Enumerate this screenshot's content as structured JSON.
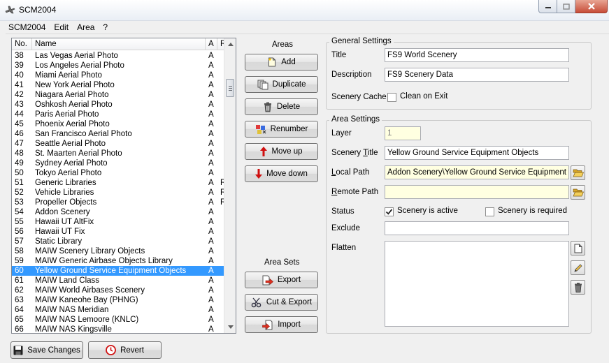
{
  "window": {
    "title": "SCM2004"
  },
  "menu": [
    "SCM2004",
    "Edit",
    "Area",
    "?"
  ],
  "list": {
    "headers": {
      "no": "No.",
      "name": "Name",
      "a": "A",
      "r": "R"
    },
    "rows": [
      {
        "no": "38",
        "name": "Las Vegas Aerial Photo",
        "a": "A",
        "r": ""
      },
      {
        "no": "39",
        "name": "Los Angeles Aerial Photo",
        "a": "A",
        "r": ""
      },
      {
        "no": "40",
        "name": "Miami Aerial Photo",
        "a": "A",
        "r": ""
      },
      {
        "no": "41",
        "name": "New York Aerial Photo",
        "a": "A",
        "r": ""
      },
      {
        "no": "42",
        "name": "Niagara Aerial Photo",
        "a": "A",
        "r": ""
      },
      {
        "no": "43",
        "name": "Oshkosh Aerial Photo",
        "a": "A",
        "r": ""
      },
      {
        "no": "44",
        "name": "Paris Aerial Photo",
        "a": "A",
        "r": ""
      },
      {
        "no": "45",
        "name": "Phoenix Aerial Photo",
        "a": "A",
        "r": ""
      },
      {
        "no": "46",
        "name": "San Francisco Aerial Photo",
        "a": "A",
        "r": ""
      },
      {
        "no": "47",
        "name": "Seattle Aerial Photo",
        "a": "A",
        "r": ""
      },
      {
        "no": "48",
        "name": "St. Maarten Aerial Photo",
        "a": "A",
        "r": ""
      },
      {
        "no": "49",
        "name": "Sydney Aerial Photo",
        "a": "A",
        "r": ""
      },
      {
        "no": "50",
        "name": "Tokyo Aerial Photo",
        "a": "A",
        "r": ""
      },
      {
        "no": "51",
        "name": "Generic Libraries",
        "a": "A",
        "r": "R"
      },
      {
        "no": "52",
        "name": "Vehicle Libraries",
        "a": "A",
        "r": "R"
      },
      {
        "no": "53",
        "name": "Propeller Objects",
        "a": "A",
        "r": "R"
      },
      {
        "no": "54",
        "name": "Addon Scenery",
        "a": "A",
        "r": ""
      },
      {
        "no": "55",
        "name": "Hawaii UT AltFix",
        "a": "A",
        "r": ""
      },
      {
        "no": "56",
        "name": "Hawaii UT Fix",
        "a": "A",
        "r": ""
      },
      {
        "no": "57",
        "name": "Static Library",
        "a": "A",
        "r": ""
      },
      {
        "no": "58",
        "name": "MAIW Scenery Library Objects",
        "a": "A",
        "r": ""
      },
      {
        "no": "59",
        "name": "MAIW Generic Airbase Objects Library",
        "a": "A",
        "r": ""
      },
      {
        "no": "60",
        "name": "Yellow Ground Service Equipment Objects",
        "a": "A",
        "r": "",
        "selected": true
      },
      {
        "no": "61",
        "name": "MAIW Land Class",
        "a": "A",
        "r": ""
      },
      {
        "no": "62",
        "name": "MAIW World Airbases Scenery",
        "a": "A",
        "r": ""
      },
      {
        "no": "63",
        "name": "MAIW Kaneohe Bay (PHNG)",
        "a": "A",
        "r": ""
      },
      {
        "no": "64",
        "name": "MAIW NAS Meridian",
        "a": "A",
        "r": ""
      },
      {
        "no": "65",
        "name": "MAIW NAS Lemoore (KNLC)",
        "a": "A",
        "r": ""
      },
      {
        "no": "66",
        "name": "MAIW NAS Kingsville",
        "a": "A",
        "r": ""
      }
    ]
  },
  "areas": {
    "label": "Areas",
    "add": "Add",
    "duplicate": "Duplicate",
    "delete": "Delete",
    "renumber": "Renumber",
    "move_up": "Move up",
    "move_down": "Move down"
  },
  "area_sets": {
    "label": "Area Sets",
    "export": "Export",
    "cut_export": "Cut & Export",
    "import": "Import"
  },
  "general": {
    "title": "General Settings",
    "title_label": "Title",
    "title_value": "FS9 World Scenery",
    "description_label": "Description",
    "description_value": "FS9 Scenery Data",
    "cache_label": "Scenery Cache",
    "cache_checkbox_label": "Clean on Exit",
    "cache_checked": false
  },
  "area_settings": {
    "title": "Area Settings",
    "layer_label": "Layer",
    "layer_value": "1",
    "scenery_title_label": "Scenery Title",
    "scenery_title_value": "Yellow Ground Service Equipment Objects",
    "local_path_label": "Local Path",
    "local_path_value": "Addon Scenery\\Yellow Ground Service Equipment Obj",
    "remote_path_label": "Remote Path",
    "remote_path_value": "",
    "status_label": "Status",
    "active_label": "Scenery is active",
    "active_checked": true,
    "required_label": "Scenery is required",
    "required_checked": false,
    "exclude_label": "Exclude",
    "exclude_value": "",
    "flatten_label": "Flatten"
  },
  "footer": {
    "save": "Save Changes",
    "revert": "Revert"
  },
  "colors": {
    "selection": "#3399ff",
    "field_yellow": "#ffffe1"
  }
}
